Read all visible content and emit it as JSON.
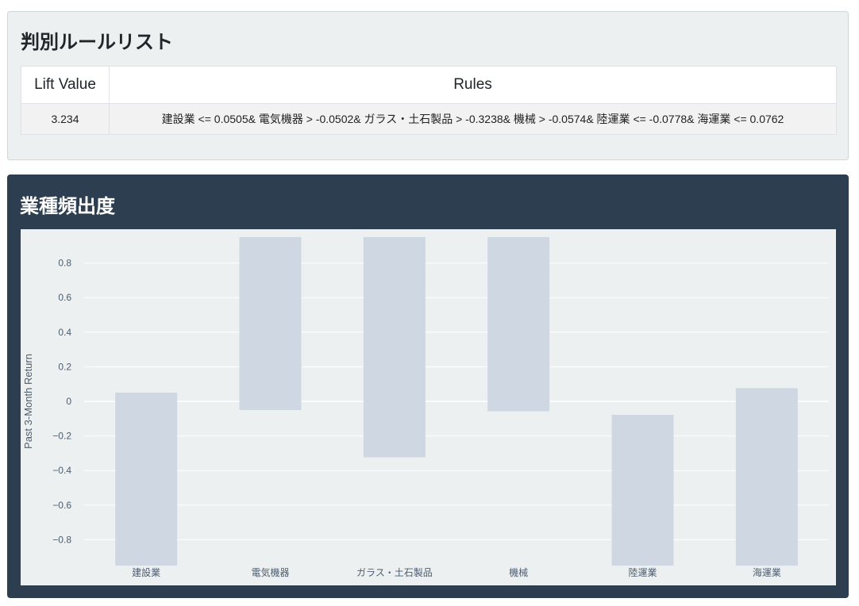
{
  "rules_card": {
    "title": "判別ルールリスト",
    "table": {
      "headers": [
        "Lift Value",
        "Rules"
      ],
      "rows": [
        {
          "lift": "3.234",
          "rule": "建設業 <= 0.0505& 電気機器 > -0.0502& ガラス・土石製品 > -0.3238& 機械 > -0.0574& 陸運業 <= -0.0778& 海運業 <= 0.0762"
        }
      ]
    }
  },
  "chart_card": {
    "title": "業種頻出度"
  },
  "chart_data": {
    "type": "bar",
    "style": "floating-range",
    "ylabel": "Past 3-Month Return",
    "xlabel": "",
    "ylim": [
      -0.95,
      0.95
    ],
    "yticks": [
      0.8,
      0.6,
      0.4,
      0.2,
      0,
      -0.2,
      -0.4,
      -0.6,
      -0.8
    ],
    "ytick_labels": [
      "0.8",
      "0.6",
      "0.4",
      "0.2",
      "0",
      "−0.2",
      "−0.4",
      "−0.6",
      "−0.8"
    ],
    "categories": [
      "建設業",
      "電気機器",
      "ガラス・土石製品",
      "機械",
      "陸運業",
      "海運業"
    ],
    "ranges": [
      {
        "low": -0.95,
        "high": 0.0505
      },
      {
        "low": -0.0502,
        "high": 0.95
      },
      {
        "low": -0.3238,
        "high": 0.95
      },
      {
        "low": -0.0574,
        "high": 0.95
      },
      {
        "low": -0.95,
        "high": -0.0778
      },
      {
        "low": -0.95,
        "high": 0.0762
      }
    ],
    "bar_color": "#cfd7e3",
    "grid": true
  }
}
